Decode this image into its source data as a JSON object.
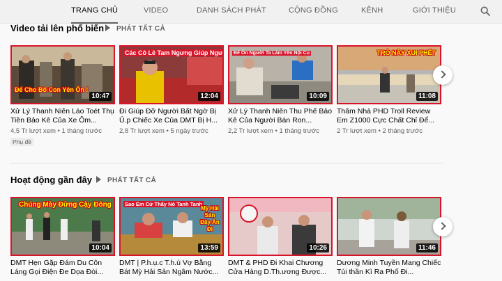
{
  "tabs": [
    {
      "label": "TRANG CHỦ",
      "active": true
    },
    {
      "label": "VIDEO"
    },
    {
      "label": "DANH SÁCH PHÁT"
    },
    {
      "label": "CỘNG ĐỒNG"
    },
    {
      "label": "KÊNH"
    },
    {
      "label": "GIỚI THIỆU"
    }
  ],
  "search_icon": "search-icon",
  "sections": [
    {
      "title": "Video tải lên phổ biến",
      "play_all": "PHÁT TẤT CẢ",
      "videos": [
        {
          "overlay": "Để Cho Bố Con Yên Ổn !",
          "duration": "10:47",
          "title": "Xử Lý Thanh Niên Láo Toét Thụ Tiền Bảo Kê Của Xe Ôm...",
          "views": "4,5 Tr lượt xem",
          "age": "1 tháng trước",
          "badge": "Phụ đề"
        },
        {
          "overlay": "Các Cô Lê Tam Ngưng Giúp Người",
          "duration": "12:04",
          "title": "Đi Giúp Đỡ Người Bất Ngờ Bị Ú.p Chiếc Xe Của DMT Bị H...",
          "views": "2,8 Tr lượt xem",
          "age": "5 ngày trước"
        },
        {
          "overlay": "Để Ôn Người Ta Làm Yên Nội Cu",
          "duration": "10:09",
          "title": "Xử Lý Thanh Niên Thu Phế Bảo Kê Của Người Bán Ron...",
          "views": "2,2 Tr lượt xem",
          "age": "1 tháng trước"
        },
        {
          "overlay": "TRÒ NÀY XUI PHẾT",
          "duration": "11:08",
          "title": "Thăm Nhà PHD Troll Review Em Z1000 Cực Chất Chỉ Để...",
          "views": "2 Tr lượt xem",
          "age": "2 tháng trước"
        }
      ]
    },
    {
      "title": "Hoạt động gần đây",
      "play_all": "PHÁT TẤT CẢ",
      "videos": [
        {
          "overlay": "Chúng Mày Đừng Cậy Đông",
          "duration": "10:04",
          "title": "DMT Hẹn Gặp Đám Du Côn Láng Gọi Điện Đe Dọa Đòi...",
          "views": "",
          "age": ""
        },
        {
          "overlay": "Sao Em Cứ Thấy Nó Tanh Tanh",
          "duration": "13:59",
          "title": "DMT | P.h.ụ.c T.h.ù Vợ Bằng Bát Mỳ Hải Sản Ngâm Nước...",
          "views": "",
          "age": ""
        },
        {
          "overlay": "",
          "duration": "10:26",
          "title": "DMT & PHD Đi Khai Chương Cửa Hàng D.Th.ương Được...",
          "views": "",
          "age": ""
        },
        {
          "overlay": "",
          "duration": "11:46",
          "title": "Dương Minh Tuyền Mang Chiếc Túi thần Kì Ra Phố Đi...",
          "views": "",
          "age": ""
        }
      ]
    }
  ],
  "thumb_side_text": "Mỳ Hải Sản Đây Ăn Đi",
  "colors": {
    "thumb_border": "#d9142a",
    "tab_bg": "#f1f1f1",
    "page_bg": "#f9f9f9"
  }
}
